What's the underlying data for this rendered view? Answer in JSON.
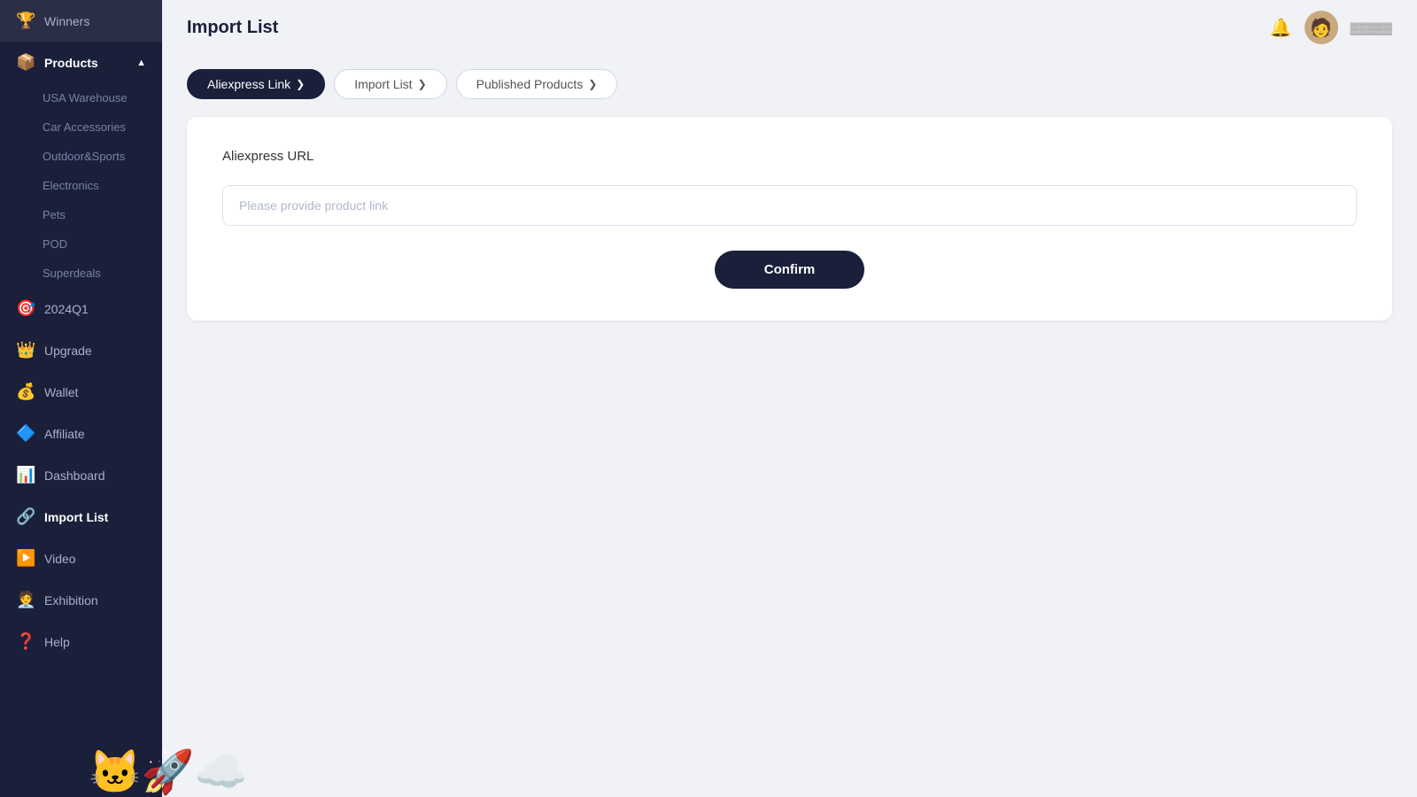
{
  "header": {
    "title": "Import List",
    "bell_icon": "🔔",
    "avatar_emoji": "🧑",
    "user_name": "User"
  },
  "sidebar": {
    "items": [
      {
        "id": "winners",
        "label": "Winners",
        "icon": "🏆",
        "active": false
      },
      {
        "id": "products",
        "label": "Products",
        "icon": "📦",
        "active": false,
        "expanded": true,
        "chevron": "▲"
      },
      {
        "id": "2024q1",
        "label": "2024Q1",
        "icon": "🎯",
        "active": false
      },
      {
        "id": "upgrade",
        "label": "Upgrade",
        "icon": "👑",
        "active": false
      },
      {
        "id": "wallet",
        "label": "Wallet",
        "icon": "💰",
        "active": false
      },
      {
        "id": "affiliate",
        "label": "Affiliate",
        "icon": "🔷",
        "active": false
      },
      {
        "id": "dashboard",
        "label": "Dashboard",
        "icon": "📊",
        "active": false
      },
      {
        "id": "import-list",
        "label": "Import List",
        "icon": "🔗",
        "active": true
      },
      {
        "id": "video",
        "label": "Video",
        "icon": "▶️",
        "active": false
      },
      {
        "id": "exhibition",
        "label": "Exhibition",
        "icon": "🧑‍💼",
        "active": false
      },
      {
        "id": "help",
        "label": "Help",
        "icon": "❓",
        "active": false
      }
    ],
    "sub_items": [
      {
        "id": "usa-warehouse",
        "label": "USA Warehouse"
      },
      {
        "id": "car-accessories",
        "label": "Car Accessories"
      },
      {
        "id": "outdoor-sports",
        "label": "Outdoor&Sports"
      },
      {
        "id": "electronics",
        "label": "Electronics"
      },
      {
        "id": "pets",
        "label": "Pets"
      },
      {
        "id": "pod",
        "label": "POD"
      },
      {
        "id": "superdeals",
        "label": "Superdeals"
      }
    ]
  },
  "tabs": [
    {
      "id": "aliexpress-link",
      "label": "Aliexpress Link",
      "active": true,
      "chevron": "❯"
    },
    {
      "id": "import-list",
      "label": "Import  List",
      "active": false,
      "chevron": "❯"
    },
    {
      "id": "published-products",
      "label": "Published Products",
      "active": false,
      "chevron": "❯"
    }
  ],
  "form": {
    "label": "Aliexpress URL",
    "input_placeholder": "Please provide product link",
    "confirm_label": "Confirm"
  }
}
